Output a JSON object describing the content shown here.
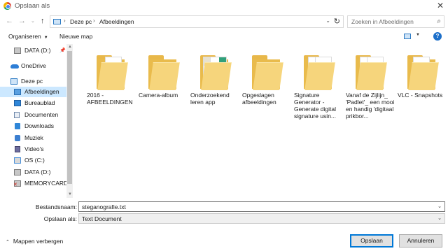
{
  "window": {
    "title": "Opslaan als",
    "close_glyph": "✕"
  },
  "address": {
    "breadcrumbs": [
      "Deze pc",
      "Afbeeldingen"
    ],
    "search_placeholder": "Zoeken in Afbeeldingen"
  },
  "toolbar": {
    "organize": "Organiseren",
    "new_folder": "Nieuwe map",
    "help": "?"
  },
  "nav": {
    "items": [
      {
        "label": "DATA (D:)",
        "icon": "drive-icon"
      },
      {
        "label": "OneDrive",
        "icon": "cloud-icon"
      },
      {
        "label": "Deze pc",
        "icon": "pc-icon"
      },
      {
        "label": "Afbeeldingen",
        "icon": "pictures-icon",
        "selected": true
      },
      {
        "label": "Bureaublad",
        "icon": "desktop-icon"
      },
      {
        "label": "Documenten",
        "icon": "documents-icon"
      },
      {
        "label": "Downloads",
        "icon": "download-icon"
      },
      {
        "label": "Muziek",
        "icon": "music-icon"
      },
      {
        "label": "Video's",
        "icon": "video-icon"
      },
      {
        "label": "OS (C:)",
        "icon": "os-drive-icon"
      },
      {
        "label": "DATA (D:)",
        "icon": "drive-icon"
      },
      {
        "label": "MEMORYCARD",
        "icon": "memorycard-icon"
      }
    ]
  },
  "folders": [
    {
      "label": "2016 - AFBEELDINGEN",
      "thumb": "paper"
    },
    {
      "label": "Camera-album",
      "thumb": "none"
    },
    {
      "label": "Onderzoekend leren app",
      "thumb": "teal"
    },
    {
      "label": "Opgeslagen afbeeldingen",
      "thumb": "none"
    },
    {
      "label": "Signature Generator - Generate digital signature usin...",
      "thumb": "paper"
    },
    {
      "label": "Vanaf de Zijlijn_ 'Padlet'_ een mooi en handig 'digitaal prikbor...",
      "thumb": "paper"
    },
    {
      "label": "VLC - Snapshots",
      "thumb": "paper"
    }
  ],
  "form": {
    "filename_label": "Bestandsnaam:",
    "filename_value": "steganografie.txt",
    "type_label": "Opslaan als:",
    "type_value": "Text Document"
  },
  "footer": {
    "hide_folders": "Mappen verbergen",
    "save": "Opslaan",
    "cancel": "Annuleren"
  },
  "colors": {
    "accent": "#0078d7",
    "selection": "#cce8ff",
    "folder": "#f6d57c"
  }
}
